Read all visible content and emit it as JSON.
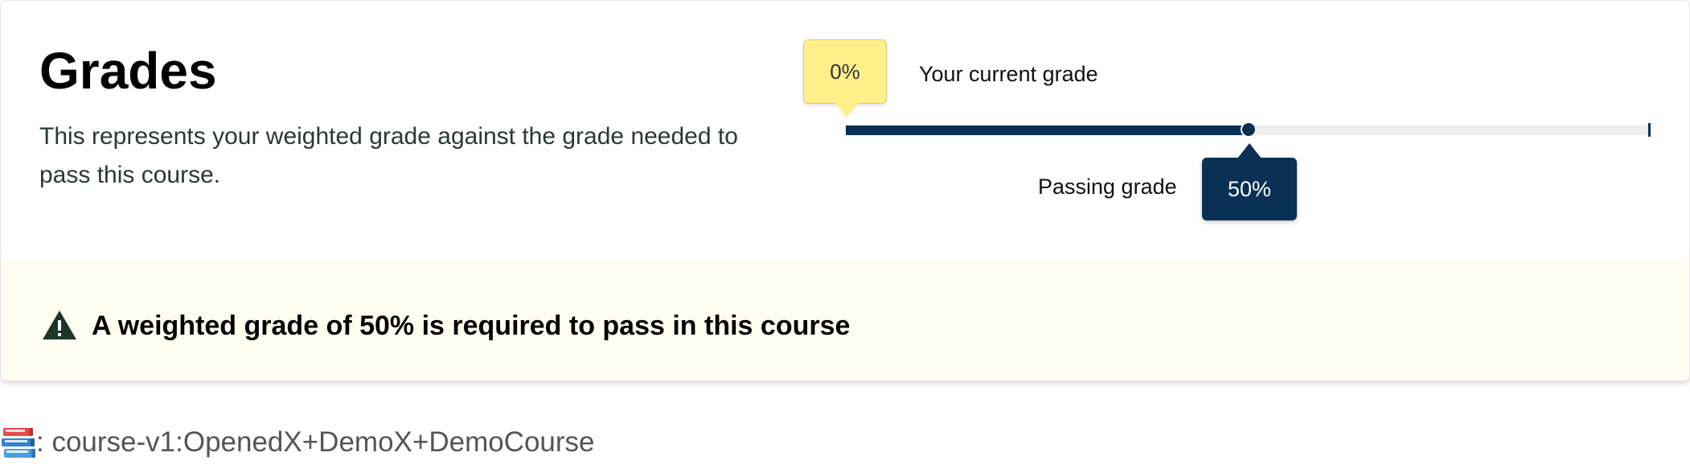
{
  "grades_card": {
    "title": "Grades",
    "description": "This represents your weighted grade against the grade needed to pass this course."
  },
  "grade_slider": {
    "current_grade": {
      "value_percent": 0,
      "label": "0%",
      "caption": "Your current grade"
    },
    "passing_grade": {
      "value_percent": 50,
      "label": "50%",
      "caption": "Passing grade"
    },
    "colors": {
      "track": "#eeeeee",
      "fill": "#0a3055",
      "current_tooltip": "#fff08b",
      "passing_tooltip": "#0a3055"
    }
  },
  "notice": {
    "icon": "warning-triangle-icon",
    "message": "A weighted grade of 50% is required to pass in this course",
    "background": "#fffdf0"
  },
  "course": {
    "icon": "books-icon",
    "text": ": course-v1:OpenedX+DemoX+DemoCourse"
  }
}
